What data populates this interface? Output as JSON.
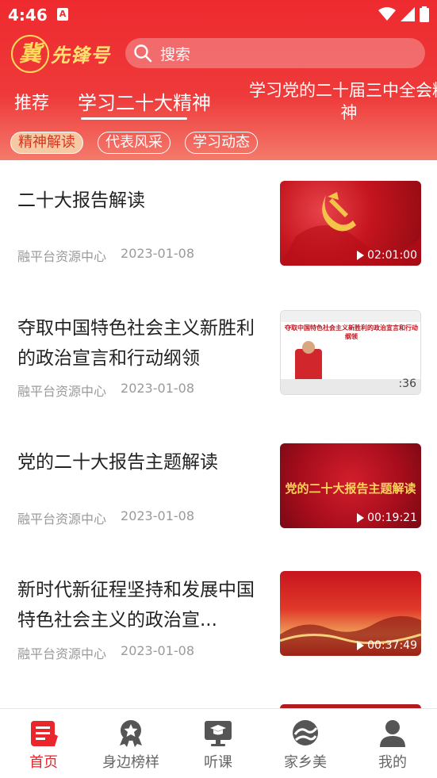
{
  "status": {
    "time": "4:46",
    "app_icon_letter": "A"
  },
  "logo": {
    "mark": "冀",
    "text": "先锋号"
  },
  "search": {
    "placeholder": "搜索"
  },
  "tabs": [
    {
      "label": "推荐",
      "active": false
    },
    {
      "label": "学习二十大精神",
      "active": true
    },
    {
      "label": "学习党的二十届三中全会精神",
      "active": false
    }
  ],
  "chips": [
    {
      "label": "精神解读",
      "active": true
    },
    {
      "label": "代表风采",
      "active": false
    },
    {
      "label": "学习动态",
      "active": false
    }
  ],
  "articles": [
    {
      "title": "二十大报告解读",
      "source": "融平台资源中心",
      "date": "2023-01-08",
      "duration": "02:01:00",
      "thumb_text": ""
    },
    {
      "title": "夺取中国特色社会主义新胜利的政治宣言和行动纲领",
      "source": "融平台资源中心",
      "date": "2023-01-08",
      "duration": ":36",
      "thumb_text": "夺取中国特色社会主义新胜利的政治宣言和行动纲领"
    },
    {
      "title": "党的二十大报告主题解读",
      "source": "融平台资源中心",
      "date": "2023-01-08",
      "duration": "00:19:21",
      "thumb_text": "党的二十大报告主题解读"
    },
    {
      "title": "新时代新征程坚持和发展中国特色社会主义的政治宣...",
      "source": "融平台资源中心",
      "date": "2023-01-08",
      "duration": "00:37:49",
      "thumb_text": ""
    }
  ],
  "tabbar": [
    {
      "label": "首页",
      "icon": "home-icon",
      "active": true
    },
    {
      "label": "身边榜样",
      "icon": "badge-icon",
      "active": false
    },
    {
      "label": "听课",
      "icon": "lecture-icon",
      "active": false
    },
    {
      "label": "家乡美",
      "icon": "hometown-icon",
      "active": false
    },
    {
      "label": "我的",
      "icon": "profile-icon",
      "active": false
    }
  ],
  "colors": {
    "accent": "#e8262c",
    "header": "#ee2a2f",
    "muted": "#9a9a9a"
  }
}
